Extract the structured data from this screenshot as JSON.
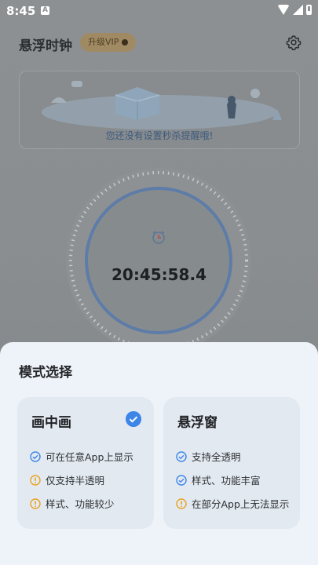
{
  "status_bar": {
    "time": "8:45",
    "notification_icon": "app-notification-icon"
  },
  "header": {
    "title": "悬浮时钟",
    "vip_label": "升级VIP",
    "settings_icon": "gear-icon"
  },
  "empty_state": {
    "message": "您还没有设置秒杀提醒哦!"
  },
  "clock": {
    "time": "20:45:58.4",
    "icon": "alarm-clock-icon"
  },
  "sheet": {
    "title": "模式选择",
    "modes": [
      {
        "name": "画中画",
        "selected": true,
        "features": [
          {
            "status": "ok",
            "text": "可在任意App上显示"
          },
          {
            "status": "warn",
            "text": "仅支持半透明"
          },
          {
            "status": "warn",
            "text": "样式、功能较少"
          }
        ]
      },
      {
        "name": "悬浮窗",
        "selected": false,
        "features": [
          {
            "status": "ok",
            "text": "支持全透明"
          },
          {
            "status": "ok",
            "text": "样式、功能丰富"
          },
          {
            "status": "warn",
            "text": "在部分App上无法显示"
          }
        ]
      }
    ]
  },
  "colors": {
    "accent": "#3d86e8",
    "warning": "#e8a21e",
    "sheet_bg": "#eef3f9",
    "card_bg": "#e3e9f1"
  }
}
